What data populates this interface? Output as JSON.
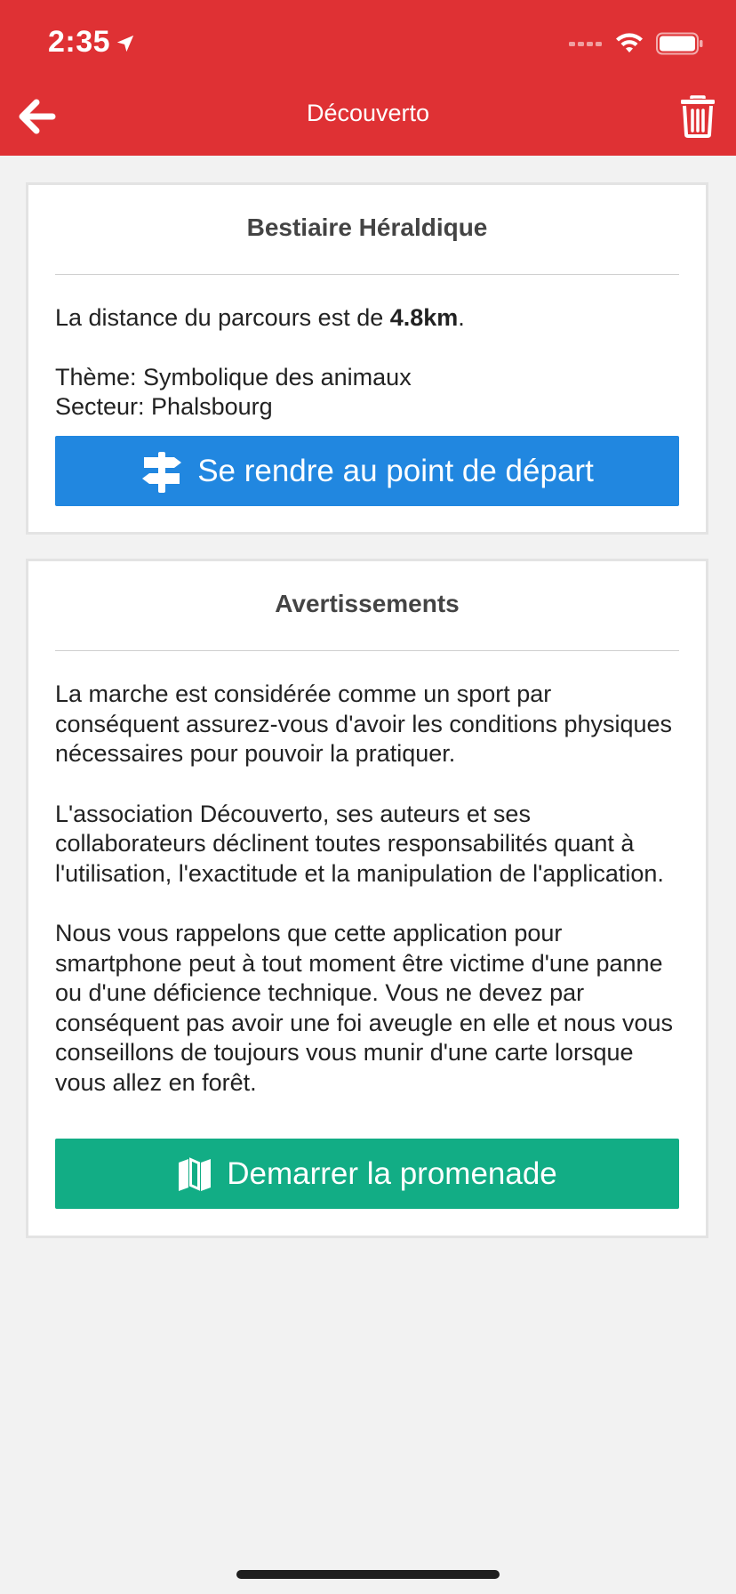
{
  "status_bar": {
    "time": "2:35",
    "icons": [
      "location-arrow-icon",
      "signal-icon",
      "wifi-icon",
      "battery-icon"
    ]
  },
  "nav": {
    "title": "Découverto",
    "back_icon": "arrow-left-icon",
    "delete_icon": "trash-icon"
  },
  "colors": {
    "header_bg": "#df3134",
    "page_bg": "#f2f2f2",
    "start_button_bg": "#2187e0",
    "walk_button_bg": "#12ad85"
  },
  "route_card": {
    "title": "Bestiaire Héraldique",
    "distance_prefix": "La distance du parcours est de ",
    "distance_value": "4.8km",
    "distance_suffix": ".",
    "theme": "Thème: Symbolique des animaux",
    "sector": "Secteur: Phalsbourg",
    "start_button_label": "Se rendre au point de départ",
    "start_button_icon": "signpost-icon"
  },
  "warnings_card": {
    "title": "Avertissements",
    "paragraphs": [
      "La marche est considérée comme un sport par conséquent assurez-vous d'avoir les conditions physiques nécessaires pour pouvoir la pratiquer.",
      "L'association Découverto, ses auteurs et ses collaborateurs déclinent toutes responsabilités quant à l'utilisation, l'exactitude et la manipulation de l'application.",
      "Nous vous rappelons que cette application pour smartphone peut à tout moment être victime d'une panne ou d'une déficience technique. Vous ne devez par conséquent pas avoir une foi aveugle en elle et nous vous conseillons de toujours vous munir d'une carte lorsque vous allez en forêt."
    ],
    "walk_button_label": "Demarrer la promenade",
    "walk_button_icon": "map-icon"
  }
}
